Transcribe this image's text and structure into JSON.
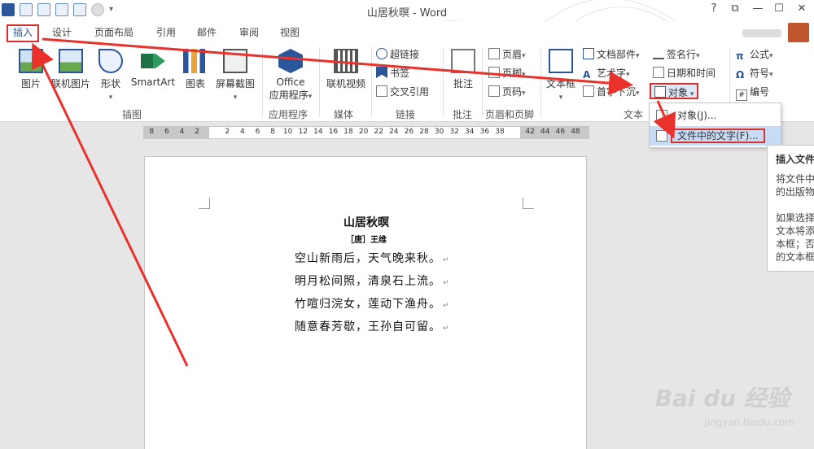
{
  "window": {
    "title": "山居秋暝 - Word",
    "controls": {
      "help": "?",
      "restore": "⧉",
      "minimize": "—",
      "maximize": "☐",
      "close": "✕"
    }
  },
  "tabs": [
    {
      "label": "插入",
      "active": true
    },
    {
      "label": "设计"
    },
    {
      "label": "页面布局"
    },
    {
      "label": "引用"
    },
    {
      "label": "邮件"
    },
    {
      "label": "审阅"
    },
    {
      "label": "视图"
    }
  ],
  "ribbon": {
    "picture": "图片",
    "online_picture": "联机图片",
    "shapes": "形状",
    "smartart": "SmartArt",
    "chart": "图表",
    "screenshot": "屏幕截图",
    "office_line1": "Office",
    "office_line2": "应用程序",
    "online_video": "联机视频",
    "hyperlink": "超链接",
    "bookmark": "书签",
    "cross_ref": "交叉引用",
    "comment": "批注",
    "header": "页眉",
    "footer": "页脚",
    "page_number": "页码",
    "textbox": "文本框",
    "quick_parts": "文档部件",
    "wordart": "艺术字",
    "drop_cap": "首字下沉",
    "signature": "签名行",
    "datetime": "日期和时间",
    "object": "对象",
    "equation": "公式",
    "symbol": "符号",
    "numbering": "编号",
    "groups": {
      "illustrations": "插图",
      "apps": "应用程序",
      "media": "媒体",
      "links": "链接",
      "comments": "批注",
      "header_footer": "页眉和页脚",
      "text": "文本"
    }
  },
  "dropdown": {
    "item1": "对象(J)...",
    "item2": "文件中的文字(F)..."
  },
  "tooltip": {
    "title": "插入文件",
    "p1a": "将文件中",
    "p1b": "的出版物",
    "p2a": "如果选择",
    "p2b": "文本将添",
    "p2c": "本框；否",
    "p2d": "的文本框"
  },
  "ruler": [
    "8",
    "6",
    "4",
    "2",
    "",
    "2",
    "4",
    "6",
    "8",
    "10",
    "12",
    "14",
    "16",
    "18",
    "20",
    "22",
    "24",
    "26",
    "28",
    "30",
    "32",
    "34",
    "36",
    "38",
    "",
    "42",
    "44",
    "46",
    "48"
  ],
  "document": {
    "title": "山居秋暝",
    "author": "［唐］王维",
    "lines": [
      "空山新雨后，天气晚来秋。",
      "明月松间照，清泉石上流。",
      "竹喧归浣女，莲动下渔舟。",
      "随意春芳歇，王孙自可留。"
    ],
    "para_mark": "↵"
  },
  "watermark": {
    "brand": "Bai du 经验",
    "url": "jingyan.baidu.com"
  },
  "colors": {
    "accent": "#2b579a",
    "highlight_red": "#d9302b",
    "hover_blue": "#c7dcf4"
  }
}
